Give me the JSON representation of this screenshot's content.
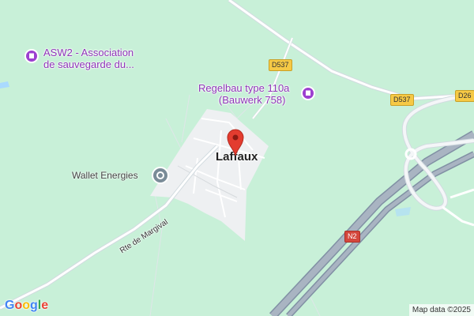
{
  "map": {
    "town": "Laffaux",
    "pois": [
      {
        "name_line1": "ASW2 - Association",
        "name_line2": "de sauvegarde du...",
        "icon": "monument-icon"
      },
      {
        "name_line1": "Regelbau type 110a",
        "name_line2": "(Bauwerk 758)",
        "icon": "monument-icon"
      }
    ],
    "business": {
      "name": "Wallet Energies",
      "icon": "business-icon"
    },
    "road_names": {
      "margival": "Rte de Margival"
    },
    "shields": {
      "d537_a": "D537",
      "d537_b": "D537",
      "d26": "D26",
      "n2": "N2"
    },
    "colors": {
      "land": "#c8f0d8",
      "town": "#eef0f2",
      "road": "#ffffff",
      "highway": "#9aa6b6",
      "poi": "#9c3fd0",
      "pin": "#e33c2f"
    }
  },
  "attribution": {
    "logo_letters": [
      "G",
      "o",
      "o",
      "g",
      "l",
      "e"
    ],
    "map_data": "Map data ©2025"
  }
}
